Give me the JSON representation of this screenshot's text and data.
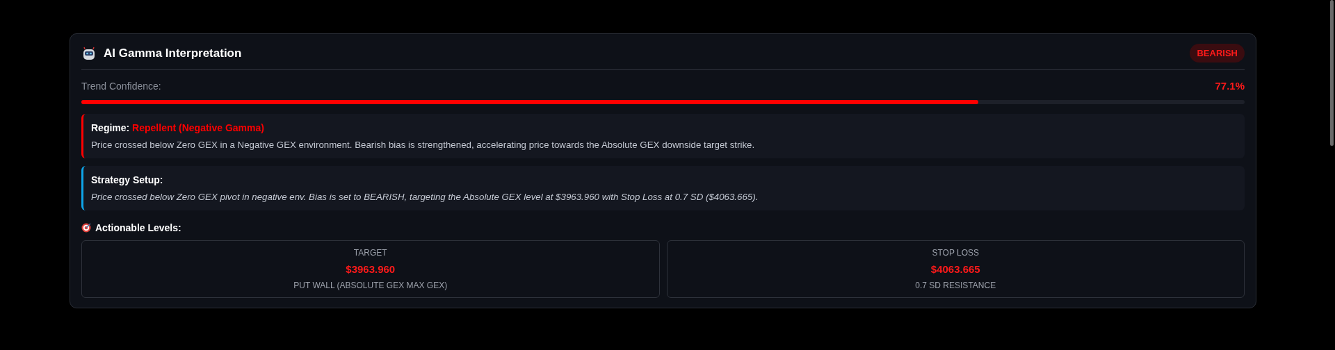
{
  "panel": {
    "title": "AI Gamma Interpretation",
    "badge": "BEARISH"
  },
  "confidence": {
    "label": "Trend Confidence:",
    "reading": "77.1%",
    "level": 0.771
  },
  "callouts": [
    {
      "kind": "regime",
      "color": "#ff0000",
      "title": "Regime:",
      "value": "Repellent (Negative Gamma)",
      "text": "Price crossed below Zero GEX in a Negative GEX environment. Bearish bias is strengthened, accelerating price towards the Absolute GEX downside target strike."
    },
    {
      "kind": "strategy",
      "color": "#0ea5e9",
      "title": "Strategy Setup:",
      "text": "Price crossed below Zero GEX pivot in negative env. Bias is set to BEARISH, targeting the Absolute GEX level at $3963.960 with Stop Loss at 0.7 SD ($4063.665)."
    }
  ],
  "levels": {
    "title": "Actionable Levels:",
    "cards": [
      {
        "label": "TARGET",
        "value": "$3963.960",
        "note": "PUT WALL (ABSOLUTE GEX MAX GEX)"
      },
      {
        "label": "STOP LOSS",
        "value": "$4063.665",
        "note": "0.7 SD RESISTANCE"
      }
    ]
  }
}
